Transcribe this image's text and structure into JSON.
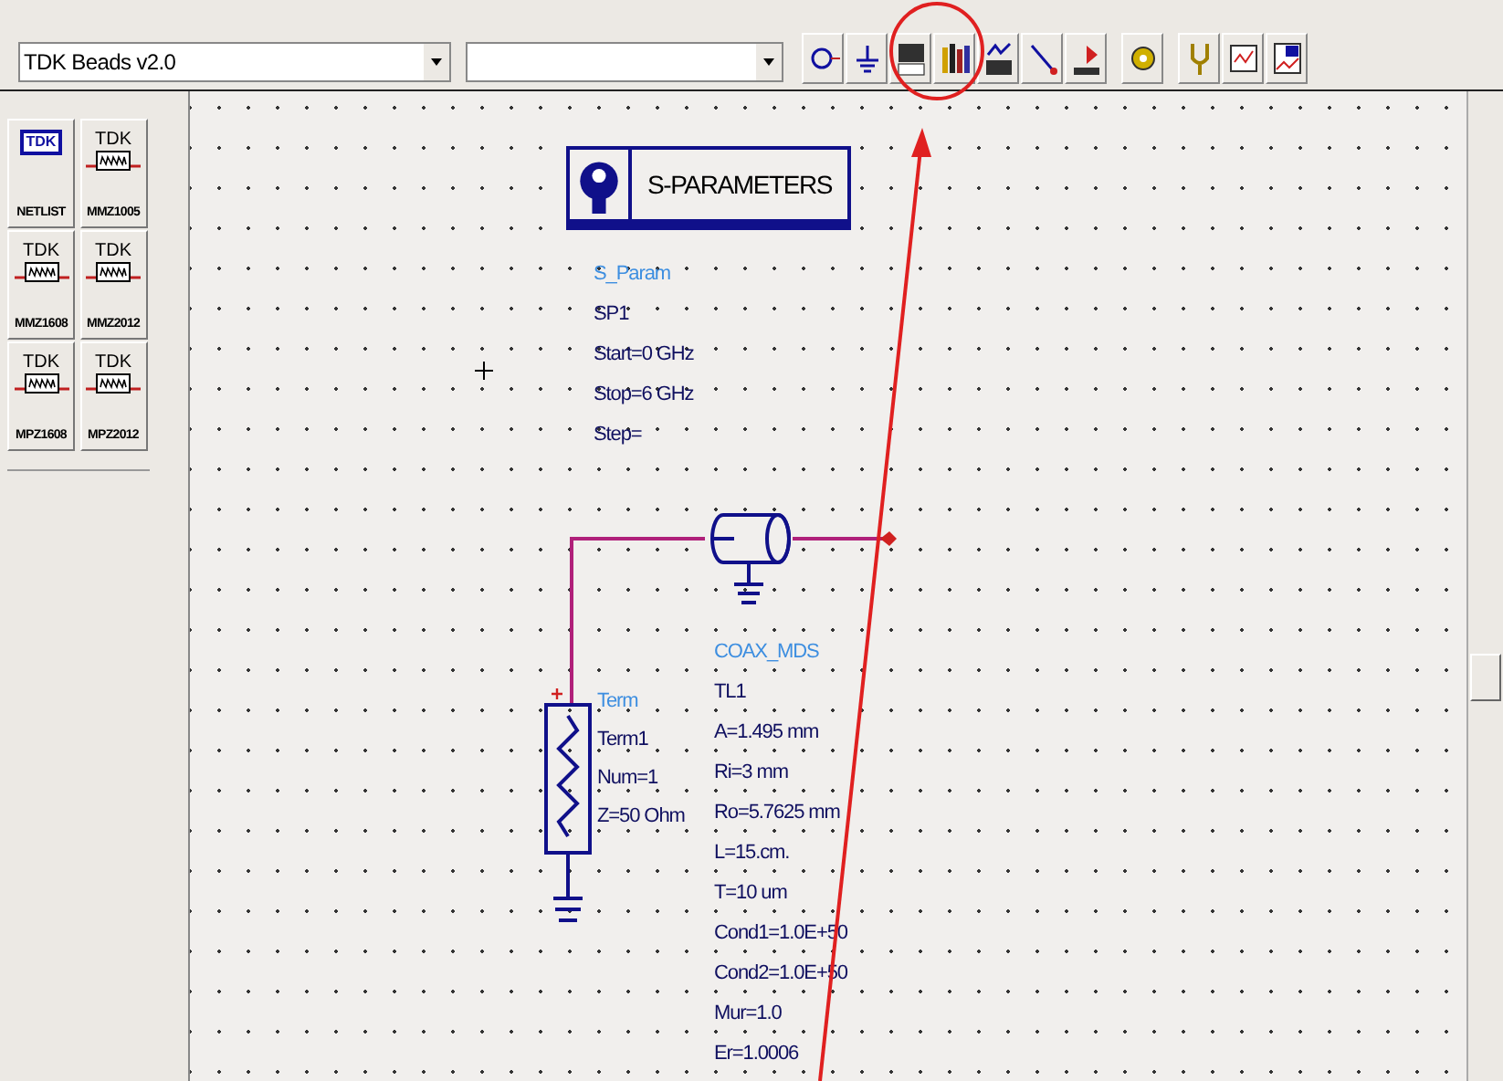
{
  "toolbar": {
    "library_combo": {
      "value": "TDK Beads v2.0"
    }
  },
  "palette": [
    {
      "brand": "TDK",
      "label": "NETLIST",
      "kind": "netlist"
    },
    {
      "brand": "TDK",
      "label": "MMZ1005",
      "kind": "bead"
    },
    {
      "brand": "TDK",
      "label": "MMZ1608",
      "kind": "bead"
    },
    {
      "brand": "TDK",
      "label": "MMZ2012",
      "kind": "bead"
    },
    {
      "brand": "TDK",
      "label": "MPZ1608",
      "kind": "bead"
    },
    {
      "brand": "TDK",
      "label": "MPZ2012",
      "kind": "bead"
    }
  ],
  "schematic": {
    "sparams": {
      "title": "S-PARAMETERS",
      "type_name": "S_Param",
      "instance": "SP1",
      "params": [
        "Start=0 GHz",
        "Stop=6 GHz",
        "Step="
      ]
    },
    "term": {
      "type_name": "Term",
      "instance": "Term1",
      "params": [
        "Num=1",
        "Z=50 Ohm"
      ]
    },
    "coax": {
      "type_name": "COAX_MDS",
      "instance": "TL1",
      "params": [
        "A=1.495 mm",
        "Ri=3 mm",
        "Ro=5.7625 mm",
        "L=15.cm.",
        "T=10 um",
        "Cond1=1.0E+50",
        "Cond2=1.0E+50",
        "Mur=1.0",
        "Er=1.0006"
      ]
    }
  }
}
